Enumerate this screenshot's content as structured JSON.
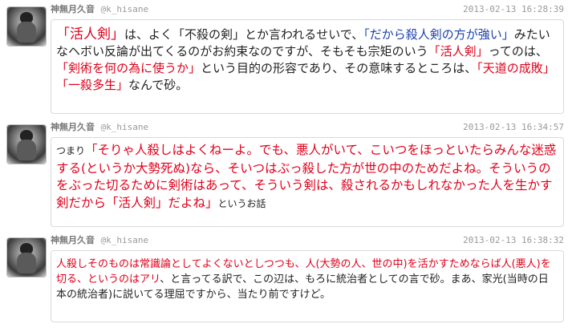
{
  "tweets": [
    {
      "name": "神無月久音",
      "handle": "@k_hisane",
      "time": "2013-02-13 16:28:39",
      "segments": [
        {
          "t": "「活人剣」",
          "c": "red big"
        },
        {
          "t": "は、よく「不殺の剣」とか言われるせいで、",
          "c": ""
        },
        {
          "t": "「だから殺人剣の方が強い」",
          "c": "blue"
        },
        {
          "t": "みたいなヘボい反論が出てくるのがお約束なのですが、そもそも宗矩のいう",
          "c": ""
        },
        {
          "t": "「活人剣」",
          "c": "red"
        },
        {
          "t": "ってのは、",
          "c": ""
        },
        {
          "t": "「剣術を何の為に使うか」",
          "c": "red"
        },
        {
          "t": "という目的の形容であり、その意味するところは、",
          "c": ""
        },
        {
          "t": "「天道の成敗」「一殺多生」",
          "c": "red"
        },
        {
          "t": "なんで砂。",
          "c": ""
        }
      ]
    },
    {
      "name": "神無月久音",
      "handle": "@k_hisane",
      "time": "2013-02-13 16:34:57",
      "segments": [
        {
          "t": "つまり",
          "c": "small"
        },
        {
          "t": "「そりゃ人殺しはよくねーよ。でも、悪人がいて、こいつをほっといたらみんな迷惑する(というか大勢死ぬ)なら、そいつはぶっ殺した方が世の中のためだよね。そういうのをぶった切るために剣術はあって、そういう剣は、殺されるかもしれなかった人を生かす剣だから「活人剣」だよね」",
          "c": "red"
        },
        {
          "t": "というお話",
          "c": "small"
        }
      ]
    },
    {
      "name": "神無月久音",
      "handle": "@k_hisane",
      "time": "2013-02-13 16:38:32",
      "segments": [
        {
          "t": "人殺しそのものは常識論としてよくないとしつつも、人(大勢の人、世の中)を活かすためならば人(悪人)を切る、というのはアリ",
          "c": "red"
        },
        {
          "t": "、と言ってる訳で、この辺は、もろに統治者としての言で砂。まあ、家光(当時の日本の統治者)に説いてる理屈ですから、当たり前ですけど。",
          "c": ""
        }
      ]
    }
  ]
}
